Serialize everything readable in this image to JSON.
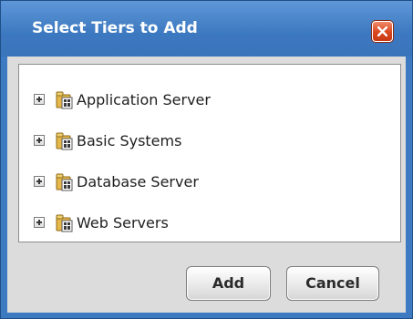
{
  "dialog": {
    "title": "Select Tiers to Add",
    "tiers": [
      {
        "label": "Application Server"
      },
      {
        "label": "Basic Systems"
      },
      {
        "label": "Database Server"
      },
      {
        "label": "Web Servers"
      }
    ],
    "buttons": {
      "add": "Add",
      "cancel": "Cancel"
    }
  },
  "icons": {
    "close": "close-icon",
    "expander": "expand-plus-icon",
    "tier": "tier-group-icon"
  },
  "colors": {
    "title_bar": "#3d7ac2",
    "close_button": "#d9461f",
    "body": "#dcdcdc",
    "panel": "#ffffff"
  }
}
